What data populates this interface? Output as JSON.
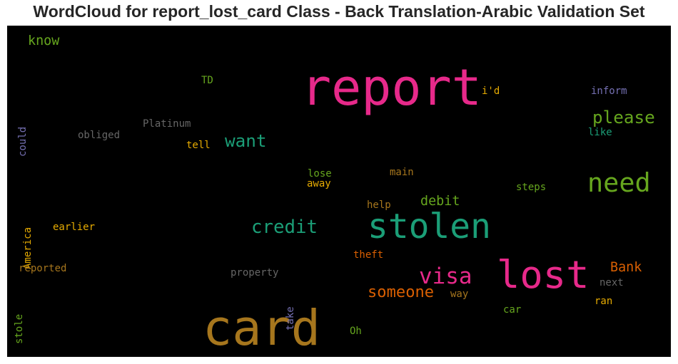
{
  "chart_data": {
    "type": "wordcloud",
    "title": "WordCloud for report_lost_card Class - Back Translation-Arabic Validation Set",
    "background": "#000000",
    "words": [
      {
        "text": "report",
        "weight": 1.0,
        "color": "#e7298a",
        "rotate": false
      },
      {
        "text": "card",
        "weight": 0.98,
        "color": "#a6761d",
        "rotate": false
      },
      {
        "text": "lost",
        "weight": 0.78,
        "color": "#e7298a",
        "rotate": false
      },
      {
        "text": "stolen",
        "weight": 0.7,
        "color": "#1b9e77",
        "rotate": false
      },
      {
        "text": "need",
        "weight": 0.55,
        "color": "#66a61e",
        "rotate": false
      },
      {
        "text": "visa",
        "weight": 0.47,
        "color": "#e7298a",
        "rotate": false
      },
      {
        "text": "credit",
        "weight": 0.4,
        "color": "#1b9e77",
        "rotate": false
      },
      {
        "text": "please",
        "weight": 0.38,
        "color": "#66a61e",
        "rotate": false
      },
      {
        "text": "want",
        "weight": 0.38,
        "color": "#1b9e77",
        "rotate": false
      },
      {
        "text": "someone",
        "weight": 0.35,
        "color": "#d95f02",
        "rotate": false
      },
      {
        "text": "debit",
        "weight": 0.3,
        "color": "#66a61e",
        "rotate": false
      },
      {
        "text": "Bank",
        "weight": 0.3,
        "color": "#d95f02",
        "rotate": false
      },
      {
        "text": "know",
        "weight": 0.3,
        "color": "#66a61e",
        "rotate": false
      },
      {
        "text": "inform",
        "weight": 0.24,
        "color": "#7570b3",
        "rotate": false
      },
      {
        "text": "Platinum",
        "weight": 0.24,
        "color": "#666666",
        "rotate": false
      },
      {
        "text": "obliged",
        "weight": 0.24,
        "color": "#666666",
        "rotate": false
      },
      {
        "text": "could",
        "weight": 0.24,
        "color": "#7570b3",
        "rotate": true
      },
      {
        "text": "i'd",
        "weight": 0.24,
        "color": "#e6ab02",
        "rotate": false
      },
      {
        "text": "TD",
        "weight": 0.24,
        "color": "#66a61e",
        "rotate": false
      },
      {
        "text": "like",
        "weight": 0.24,
        "color": "#1b9e77",
        "rotate": false
      },
      {
        "text": "tell",
        "weight": 0.24,
        "color": "#e6ab02",
        "rotate": false
      },
      {
        "text": "lose",
        "weight": 0.24,
        "color": "#66a61e",
        "rotate": false
      },
      {
        "text": "away",
        "weight": 0.24,
        "color": "#e6ab02",
        "rotate": false
      },
      {
        "text": "main",
        "weight": 0.24,
        "color": "#a6761d",
        "rotate": false
      },
      {
        "text": "steps",
        "weight": 0.24,
        "color": "#66a61e",
        "rotate": false
      },
      {
        "text": "help",
        "weight": 0.24,
        "color": "#a6761d",
        "rotate": false
      },
      {
        "text": "earlier",
        "weight": 0.24,
        "color": "#e6ab02",
        "rotate": false
      },
      {
        "text": "America",
        "weight": 0.24,
        "color": "#e6ab02",
        "rotate": true
      },
      {
        "text": "reported",
        "weight": 0.24,
        "color": "#a6761d",
        "rotate": false
      },
      {
        "text": "theft",
        "weight": 0.24,
        "color": "#d95f02",
        "rotate": false
      },
      {
        "text": "property",
        "weight": 0.24,
        "color": "#666666",
        "rotate": false
      },
      {
        "text": "take",
        "weight": 0.24,
        "color": "#7570b3",
        "rotate": true
      },
      {
        "text": "way",
        "weight": 0.24,
        "color": "#a6761d",
        "rotate": false
      },
      {
        "text": "next",
        "weight": 0.24,
        "color": "#666666",
        "rotate": false
      },
      {
        "text": "stole",
        "weight": 0.24,
        "color": "#66a61e",
        "rotate": true
      },
      {
        "text": "car",
        "weight": 0.24,
        "color": "#66a61e",
        "rotate": false
      },
      {
        "text": "ran",
        "weight": 0.24,
        "color": "#e6ab02",
        "rotate": false
      },
      {
        "text": "Oh",
        "weight": 0.24,
        "color": "#66a61e",
        "rotate": false
      }
    ]
  }
}
